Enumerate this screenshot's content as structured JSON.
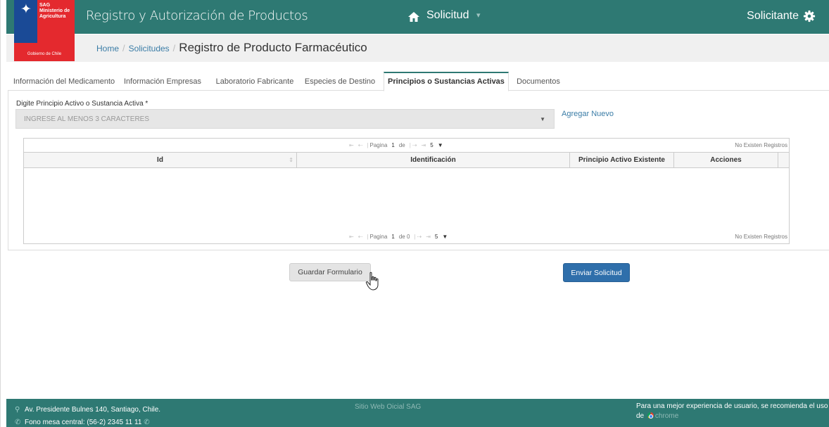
{
  "logo": {
    "org_name": "SAG Ministerio de Agricultura",
    "gov_label": "Gobierno de Chile"
  },
  "header": {
    "app_title": "Registro y Autorización de Productos",
    "nav_label": "Solicitud",
    "user_label": "Solicitante"
  },
  "breadcrumb": {
    "home": "Home",
    "solicitudes": "Solicitudes",
    "separator": "/",
    "current": "Registro de Producto Farmacéutico"
  },
  "tabs": [
    {
      "label": "Información del Medicamento",
      "active": false
    },
    {
      "label": "Información Empresas",
      "active": false
    },
    {
      "label": "Laboratorio Fabricante",
      "active": false
    },
    {
      "label": "Especies de Destino",
      "active": false
    },
    {
      "label": "Principios o Sustancias Activas",
      "active": true
    },
    {
      "label": "Documentos",
      "active": false
    }
  ],
  "form": {
    "field_label": "Digite Principio Activo o Sustancia Activa *",
    "select_placeholder": "INGRESE AL MENOS 3 CARACTERES",
    "add_new_link": "Agregar Nuevo"
  },
  "grid": {
    "columns": [
      "Id",
      "Identificación",
      "Principio Activo Existente",
      "Acciones"
    ],
    "pager_top": {
      "page_label": "Pagina",
      "page": "1",
      "of_label": "de",
      "rows_per_page": "5"
    },
    "pager_bottom": {
      "page_label": "Pagina",
      "page": "1",
      "of_label": "de 0",
      "rows_per_page": "5"
    },
    "no_records": "No Existen Registros",
    "rows": []
  },
  "buttons": {
    "save": "Guardar Formulario",
    "submit": "Enviar Solicitud"
  },
  "footer": {
    "address": "Av. Presidente Bulnes 140, Santiago, Chile.",
    "phone": "Fono mesa central: (56-2) 2345 11 11",
    "site_label": "Sitio Web Oicial SAG",
    "recommend": "Para una mejor experiencia de usuario, se recomienda el uso de",
    "chrome_label": "chrome"
  },
  "colors": {
    "header_bg": "#2e7973",
    "link": "#3a7ca6",
    "primary_button": "#2f6fab"
  }
}
